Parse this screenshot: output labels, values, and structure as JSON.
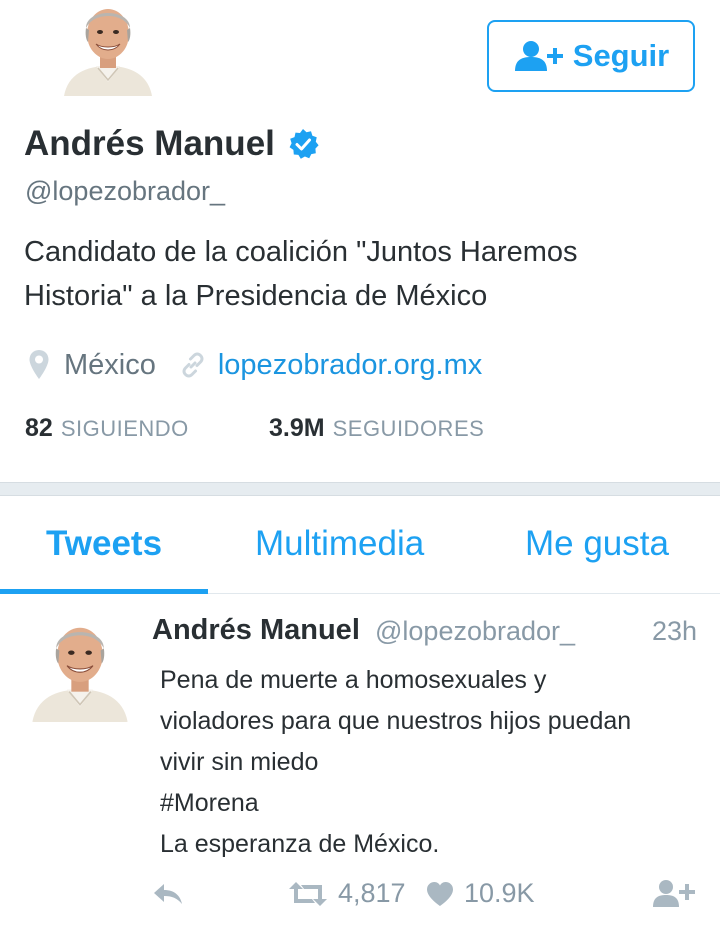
{
  "profile": {
    "name": "Andrés Manuel",
    "handle": "@lopezobrador_",
    "bio_lines": [
      "Candidato de la coalición \"Juntos Haremos",
      "Historia\" a la Presidencia de México"
    ],
    "location": "México",
    "website": "lopezobrador.org.mx",
    "following_count": "82",
    "following_label": "SIGUIENDO",
    "followers_count": "3.9M",
    "followers_label": "SEGUIDORES",
    "follow_button_label": "Seguir",
    "verified_icon": "verified-badge-icon"
  },
  "tabs": [
    {
      "label": "Tweets",
      "active": true
    },
    {
      "label": "Multimedia",
      "active": false
    },
    {
      "label": "Me gusta",
      "active": false
    }
  ],
  "tweet": {
    "name": "Andrés Manuel",
    "handle": "@lopezobrador_",
    "time": "23h",
    "text_lines": [
      "Pena de muerte a homosexuales y",
      "violadores para que nuestros hijos puedan",
      "vivir sin miedo",
      "#Morena",
      "La esperanza de México."
    ],
    "retweets": "4,817",
    "likes": "10.9K"
  },
  "colors": {
    "accent": "#1da1f2",
    "link": "#1b95e0",
    "text": "#292f33",
    "muted": "#8899a6",
    "band": "#e6ecf0"
  },
  "icons": {
    "follow": "add-user-icon",
    "location": "location-pin-icon",
    "link": "link-icon",
    "reply": "reply-icon",
    "retweet": "retweet-icon",
    "like": "heart-icon",
    "follow_small": "add-user-icon"
  }
}
